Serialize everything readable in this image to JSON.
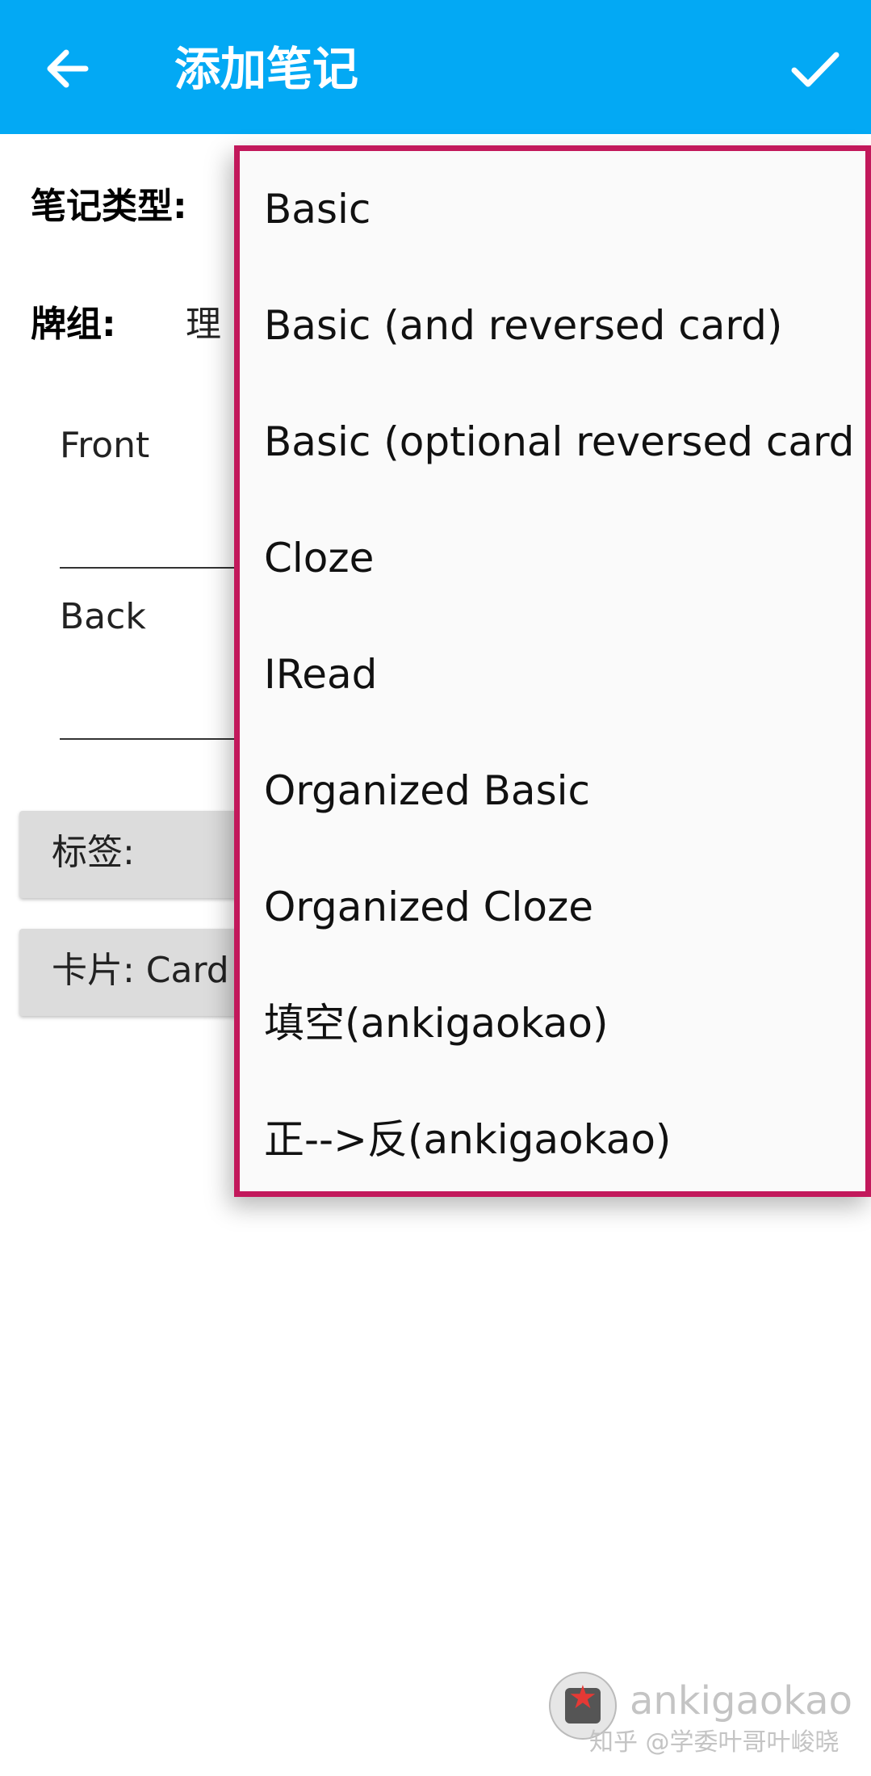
{
  "toolbar": {
    "title": "添加笔记",
    "back_icon": "arrow-left-icon",
    "confirm_icon": "check-icon",
    "color": "#03a9f4"
  },
  "form": {
    "note_type_label": "笔记类型:",
    "deck_label": "牌组:",
    "deck_value": "理",
    "fields": [
      {
        "label": "Front"
      },
      {
        "label": "Back"
      }
    ],
    "tags_label": "标签:",
    "cards_label": "卡片: Card"
  },
  "dropdown": {
    "border_color": "#c2185b",
    "items": [
      {
        "label": "Basic"
      },
      {
        "label": "Basic (and reversed card)"
      },
      {
        "label": "Basic (optional reversed card)"
      },
      {
        "label": "Cloze"
      },
      {
        "label": "IRead"
      },
      {
        "label": "Organized Basic"
      },
      {
        "label": "Organized Cloze"
      },
      {
        "label": "填空(ankigaokao)"
      },
      {
        "label": "正-->反(ankigaokao)"
      }
    ]
  },
  "watermark": {
    "name": "ankigaokao",
    "sub": "知乎 @学委叶哥叶峻晓"
  }
}
